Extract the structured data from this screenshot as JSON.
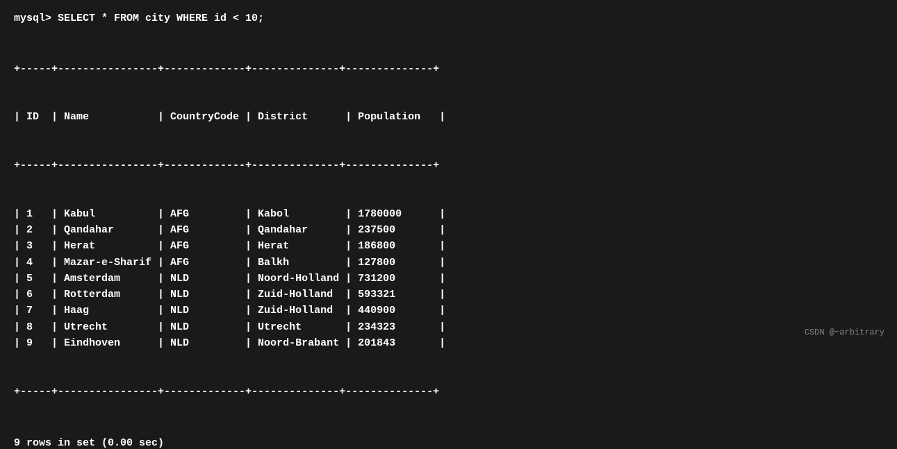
{
  "command": "mysql> SELECT * FROM city WHERE id < 10;",
  "divider_top": "+-----+----------------+-------------+--------------+--------------+",
  "header": "| ID  | Name           | CountryCode | District      | Population   |",
  "divider_mid": "+-----+----------------+-------------+--------------+--------------+",
  "rows": [
    "| 1   | Kabul          | AFG         | Kabol         | 1780000      |",
    "| 2   | Qandahar       | AFG         | Qandahar      | 237500       |",
    "| 3   | Herat          | AFG         | Herat         | 186800       |",
    "| 4   | Mazar-e-Sharif | AFG         | Balkh         | 127800       |",
    "| 5   | Amsterdam      | NLD         | Noord-Holland | 731200       |",
    "| 6   | Rotterdam      | NLD         | Zuid-Holland  | 593321       |",
    "| 7   | Haag           | NLD         | Zuid-Holland  | 440900       |",
    "| 8   | Utrecht        | NLD         | Utrecht       | 234323       |",
    "| 9   | Eindhoven      | NLD         | Noord-Brabant | 201843       |"
  ],
  "divider_bot": "+-----+----------------+-------------+--------------+--------------+",
  "footer": "9 rows in set (0.00 sec)",
  "watermark": "CSDN @~arbitrary"
}
